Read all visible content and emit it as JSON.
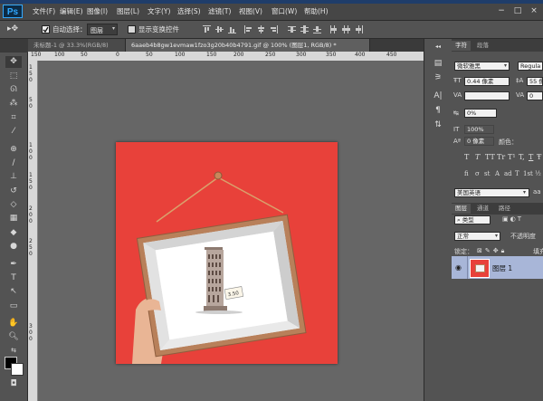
{
  "app": {
    "logo": "Ps"
  },
  "menu": [
    {
      "label": "文件(F)"
    },
    {
      "label": "编辑(E)"
    },
    {
      "label": "图像(I)"
    },
    {
      "label": "图层(L)"
    },
    {
      "label": "文字(Y)"
    },
    {
      "label": "选择(S)"
    },
    {
      "label": "滤镜(T)"
    },
    {
      "label": "视图(V)"
    },
    {
      "label": "窗口(W)"
    },
    {
      "label": "帮助(H)"
    }
  ],
  "window_controls": {
    "minimize": "−",
    "maximize": "□",
    "close": "×"
  },
  "options": {
    "auto_select_label": "自动选择：",
    "auto_select_value": "图层",
    "show_transform_label": "显示变换控件",
    "auto_select_checked": true,
    "show_transform_checked": false
  },
  "tabs": [
    {
      "label": "未标题-1 @ 33.3%(RGB/8)",
      "active": false
    },
    {
      "label": "6aaeb4b8gw1evmaw1fzo3g20b40b4791.gif @ 100% (图层1, RGB/8) *",
      "active": true
    }
  ],
  "ruler": {
    "top": [
      "150",
      "100",
      "50",
      "0",
      "50",
      "100",
      "150",
      "200",
      "250",
      "300",
      "350",
      "400",
      "450"
    ],
    "left": [
      "1",
      "5",
      "0",
      "5",
      "0",
      "1",
      "0",
      "0",
      "1",
      "5",
      "0",
      "2",
      "0",
      "0",
      "2",
      "5",
      "0",
      "3",
      "0",
      "0"
    ]
  },
  "tools": [
    "move-tool",
    "marquee-tool",
    "lasso-tool",
    "quick-select-tool",
    "crop-tool",
    "eyedropper-tool",
    "spot-heal-tool",
    "brush-tool",
    "clone-stamp-tool",
    "history-brush-tool",
    "eraser-tool",
    "gradient-tool",
    "blur-tool",
    "dodge-tool",
    "pen-tool",
    "type-tool",
    "path-select-tool",
    "shape-tool",
    "hand-tool",
    "zoom-tool"
  ],
  "colors": {
    "canvas_bg": "#e8413a",
    "foreground": "#000000",
    "background": "#ffffff",
    "frame": "#b8805a",
    "layer_highlight": "#a8b6d8"
  },
  "character_panel": {
    "tab_character": "字符",
    "tab_paragraph": "段落",
    "font_family": "微软雅黑",
    "font_style": "Regula",
    "font_size": "0.44 像素",
    "leading": "55 像",
    "kerning": "",
    "tracking": "0",
    "scale_percent": "0%",
    "vertical_scale": "100%",
    "baseline_shift": "0 像素",
    "color_label": "颜色：",
    "typo_buttons": [
      "T",
      "T",
      "TT",
      "Tr",
      "T¹",
      "T,",
      "T",
      "Ŧ"
    ],
    "ligature_buttons": [
      "fi",
      "σ",
      "st",
      "A",
      "ad",
      "T",
      "1st",
      "½"
    ],
    "language": "美国英语",
    "antialias": "aa"
  },
  "layers_panel": {
    "tab_layers": "图层",
    "tab_channels": "通道",
    "tab_paths": "路径",
    "filter_kind": "类型",
    "blend_mode": "正常",
    "opacity_label": "不透明度",
    "lock_label": "锁定：",
    "fill_label": "填充",
    "layer_name": "图层 1"
  },
  "artwork": {
    "tag_text": "3.50"
  }
}
